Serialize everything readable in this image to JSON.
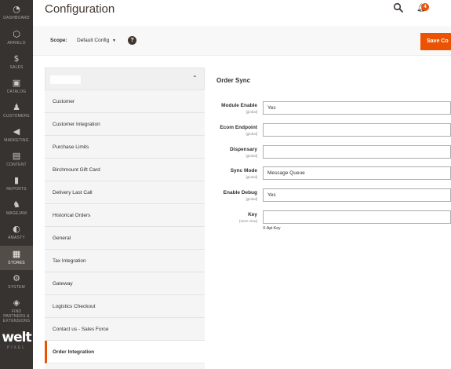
{
  "nav": {
    "items": [
      {
        "label": "DASHBOARD",
        "icon": "dashboard-icon",
        "glyph": "◔"
      },
      {
        "label": "ARRIELO",
        "icon": "hexagon-icon",
        "glyph": "⬡"
      },
      {
        "label": "SALES",
        "icon": "dollar-icon",
        "glyph": "$"
      },
      {
        "label": "CATALOG",
        "icon": "cube-icon",
        "glyph": "▣"
      },
      {
        "label": "CUSTOMERS",
        "icon": "person-icon",
        "glyph": "♟"
      },
      {
        "label": "MARKETING",
        "icon": "megaphone-icon",
        "glyph": "◀"
      },
      {
        "label": "CONTENT",
        "icon": "layout-icon",
        "glyph": "▤"
      },
      {
        "label": "REPORTS",
        "icon": "bar-chart-icon",
        "glyph": "▮"
      },
      {
        "label": "MAGEJAM",
        "icon": "paw-icon",
        "glyph": "♞"
      },
      {
        "label": "AMASTY",
        "icon": "amasty-icon",
        "glyph": "◐"
      },
      {
        "label": "STORES",
        "icon": "store-icon",
        "glyph": "▦"
      },
      {
        "label": "SYSTEM",
        "icon": "gear-icon",
        "glyph": "⚙"
      },
      {
        "label": "FIND PARTNERS & EXTENSIONS",
        "icon": "extensions-icon",
        "glyph": "◈"
      }
    ],
    "active_label": "STORES",
    "brand": {
      "word": "welt",
      "sub": "PIXEL"
    }
  },
  "header": {
    "title": "Configuration",
    "notification_count": "4"
  },
  "scope_bar": {
    "label": "Scope:",
    "value": "Default Config",
    "save_label": "Save Co"
  },
  "tabs": {
    "items": [
      "Customer",
      "Customer Integration",
      "Purchase Limits",
      "Birchmount Gift Card",
      "Delivery Last Call",
      "Historical Orders",
      "General",
      "Tax Integration",
      "Gateway",
      "Logistics Checkout",
      "Contact us - Sales Force",
      "Order Integration"
    ],
    "active": "Order Integration"
  },
  "form": {
    "section_title": "Order Sync",
    "fields": [
      {
        "label": "Module Enable",
        "scope": "[global]",
        "value": "Yes"
      },
      {
        "label": "Ecom Endpoint",
        "scope": "[global]",
        "value": ""
      },
      {
        "label": "Dispensary",
        "scope": "[global]",
        "value": ""
      },
      {
        "label": "Sync Mode",
        "scope": "[global]",
        "value": "Message Queue"
      },
      {
        "label": "Enable Debug",
        "scope": "[global]",
        "value": "Yes"
      },
      {
        "label": "Key",
        "scope": "[store view]",
        "value": ""
      }
    ],
    "key_note": "X-Api-Key"
  },
  "colors": {
    "nav_bg": "#373330",
    "accent": "#eb5202",
    "scope_bg": "#f8f8f8"
  }
}
